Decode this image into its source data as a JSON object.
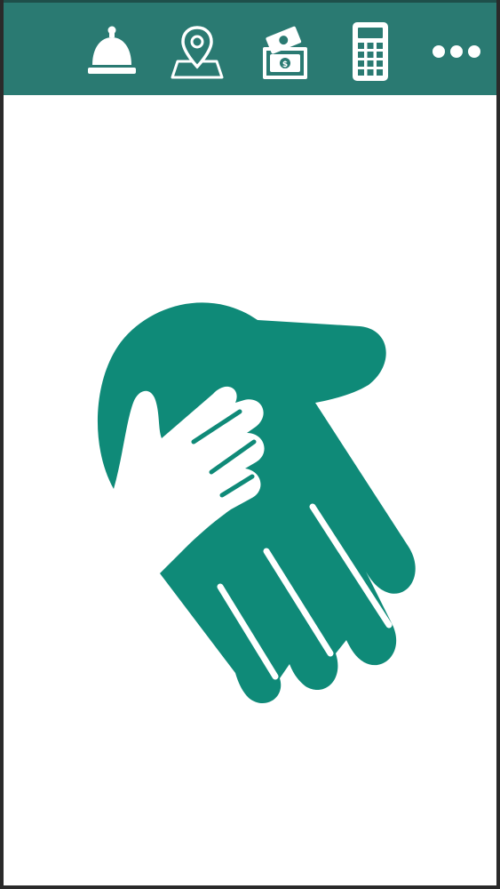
{
  "colors": {
    "toolbar_bg": "#2a7a72",
    "brand_green": "#0f8a78",
    "icon_color": "#ffffff",
    "background": "#ffffff"
  },
  "toolbar": {
    "items": [
      {
        "icon": "service-bell-icon"
      },
      {
        "icon": "map-location-pin-icon"
      },
      {
        "icon": "money-wallet-icon"
      },
      {
        "icon": "calculator-icon"
      },
      {
        "icon": "more-dots-icon"
      }
    ]
  },
  "main": {
    "logo_icon": "helping-hands-icon"
  }
}
